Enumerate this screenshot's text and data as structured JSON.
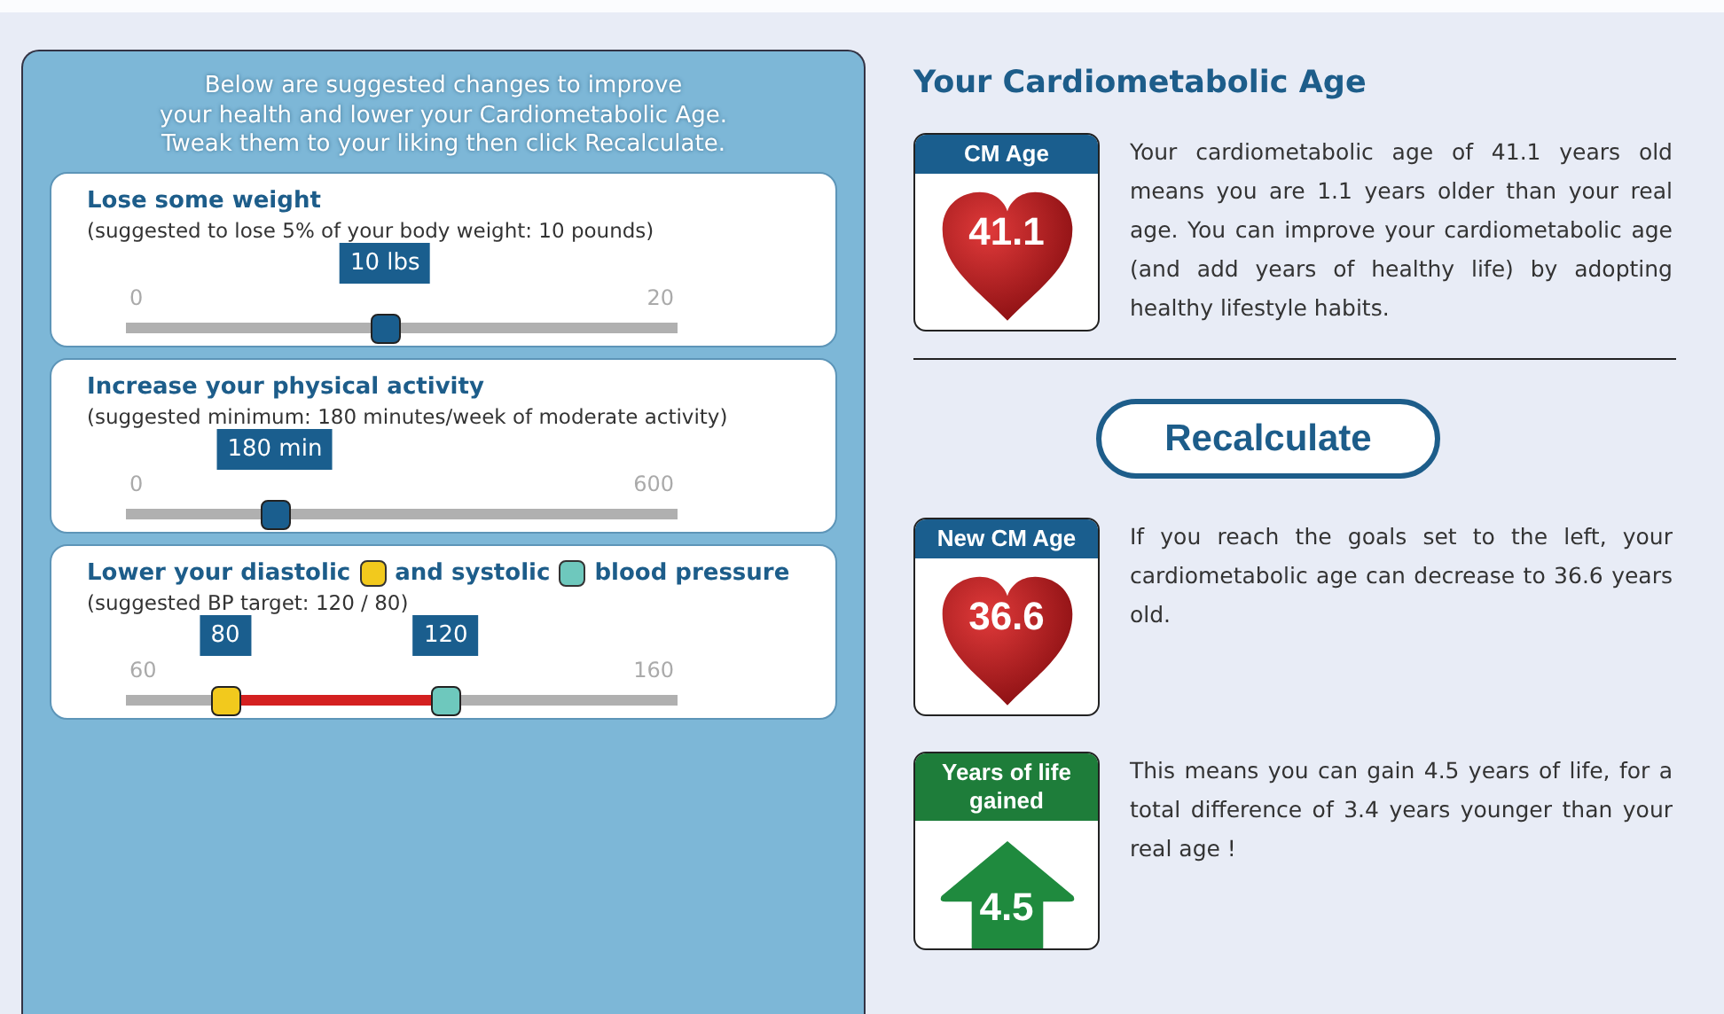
{
  "intro": "Below are suggested changes to improve\nyour health and lower your Cardiometabolic Age.\nTweak them to your liking then click Recalculate.",
  "goals": [
    {
      "kind": "single",
      "title_parts": [
        {
          "text": "Lose some weight"
        }
      ],
      "subtitle": "(suggested to lose 5% of your body weight: 10 pounds)",
      "min": "0",
      "max": "20",
      "handles": [
        {
          "value": "10 lbs",
          "level": 0.47
        }
      ]
    },
    {
      "kind": "single",
      "title_parts": [
        {
          "text": "Increase your physical activity"
        }
      ],
      "subtitle": "(suggested minimum: 180 minutes/week of moderate activity)",
      "min": "0",
      "max": "600",
      "handles": [
        {
          "value": "180 min",
          "level": 0.27
        }
      ]
    },
    {
      "kind": "range",
      "title_parts": [
        {
          "text": "Lower your diastolic",
          "legend": true
        },
        {
          "text": "and systolic",
          "legend": true
        },
        {
          "text": "blood pressure",
          "legend": false
        }
      ],
      "subtitle": "(suggested BP target: 120 / 80)",
      "min": "60",
      "max": "160",
      "handles": [
        {
          "value": "80",
          "level": 0.18,
          "color": "#f2c91d"
        },
        {
          "value": "120",
          "level": 0.58,
          "color": "#6ec8bd"
        }
      ]
    }
  ],
  "result_title": "Your Cardiometabolic Age",
  "results": [
    {
      "kind": "heart",
      "header": "CM Age",
      "value": "41.1",
      "text": "Your cardiometabolic age of 41.1 years old means you are 1.1 years older than your real age. You can improve your cardiometabolic age (and add years of healthy life) by adopting healthy lifestyle habits."
    },
    {
      "kind": "heart",
      "header": "New CM Age",
      "value": "36.6",
      "text": "If you reach the goals set to the left, your cardiometabolic age can decrease to 36.6 years old."
    },
    {
      "kind": "arrow",
      "header": "Years of life gained",
      "value": "4.5",
      "text": "This means you can gain 4.5 years of life, for a total difference of 3.4 years younger than your real age !"
    }
  ],
  "button": "Recalculate"
}
